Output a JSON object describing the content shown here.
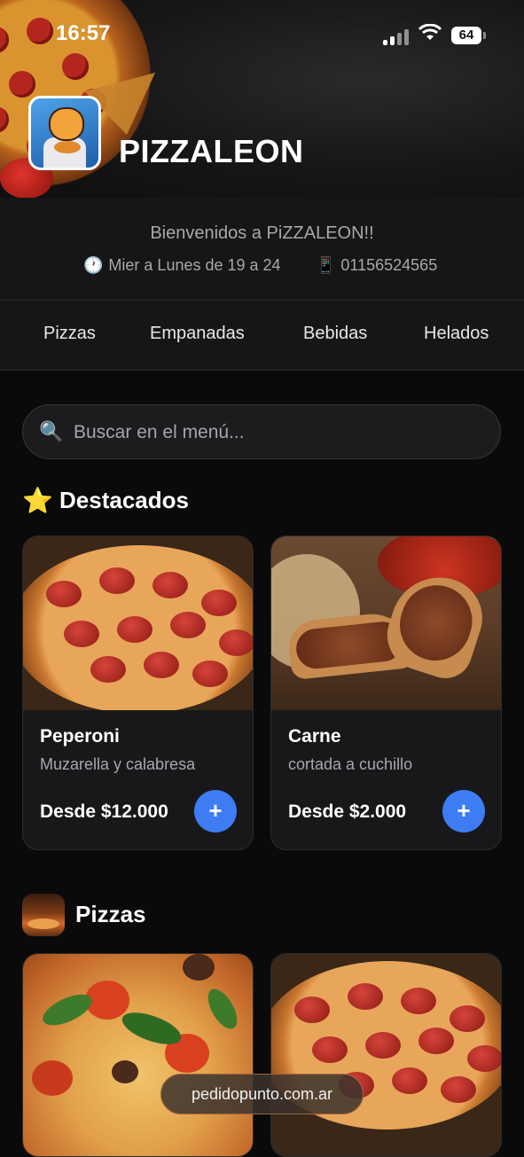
{
  "status_bar": {
    "time": "16:57",
    "battery": "64"
  },
  "header": {
    "brand": "PIZZALEON"
  },
  "info": {
    "welcome": "Bienvenidos a PiZZALEON!!",
    "hours_icon": "🕐",
    "hours": "Mier a Lunes de 19 a 24",
    "phone_icon": "📱",
    "phone": "01156524565"
  },
  "tabs": [
    "Pizzas",
    "Empanadas",
    "Bebidas",
    "Helados"
  ],
  "search": {
    "placeholder": "Buscar en el menú..."
  },
  "featured": {
    "title": "Destacados",
    "items": [
      {
        "name": "Peperoni",
        "desc": "Muzarella y calabresa",
        "price": "Desde $12.000"
      },
      {
        "name": "Carne",
        "desc": "cortada a cuchillo",
        "price": "Desde $2.000"
      }
    ]
  },
  "pizzas": {
    "title": "Pizzas"
  },
  "add_label": "+",
  "footer": {
    "watermark": "pedidopunto.com.ar"
  },
  "colors": {
    "accent": "#3d7cf2",
    "background": "#0a0a0b",
    "card": "#18181a"
  },
  "icons": [
    "signal-icon",
    "wifi-icon",
    "battery-icon",
    "clock-icon",
    "phone-icon",
    "search-icon",
    "star-icon",
    "add-icon"
  ]
}
